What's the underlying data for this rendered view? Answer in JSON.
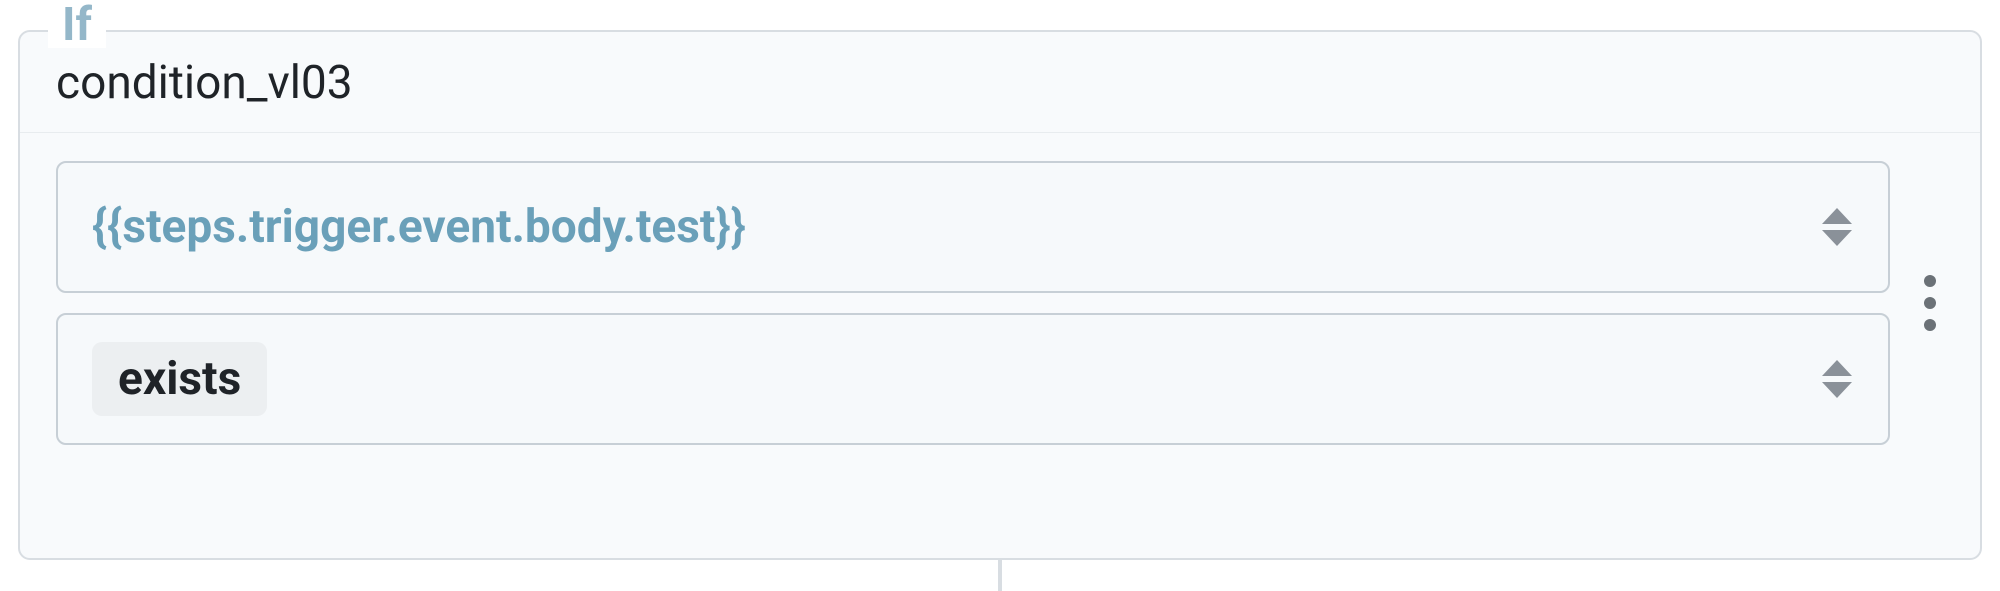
{
  "block": {
    "legend": "If",
    "title": "condition_vl03",
    "expression": "{{steps.trigger.event.body.test}}",
    "operator": "exists"
  }
}
